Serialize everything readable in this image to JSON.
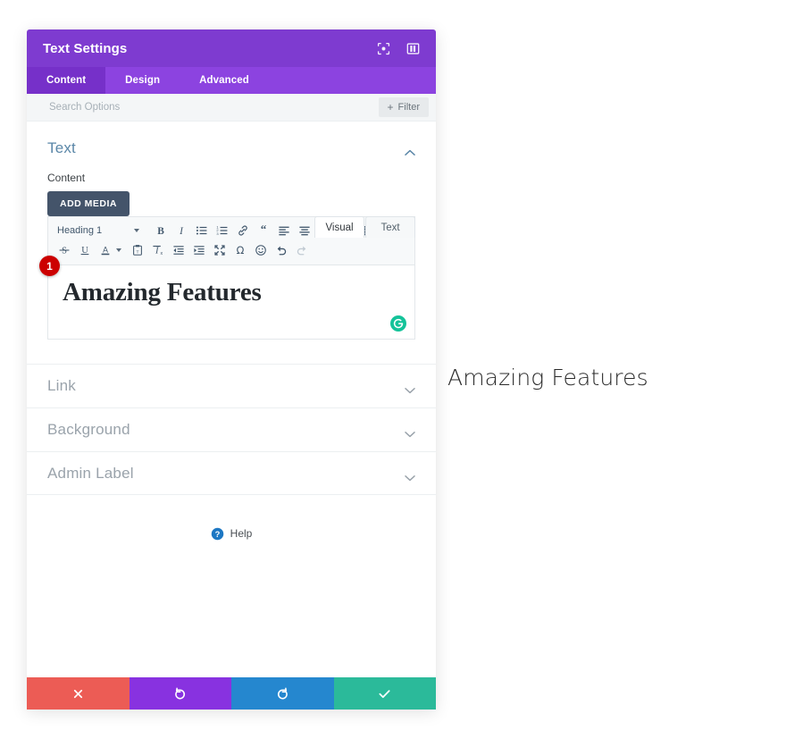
{
  "window": {
    "title": "Text Settings",
    "header_icons": [
      {
        "name": "focus-icon"
      },
      {
        "name": "layout-panel-icon"
      }
    ]
  },
  "tabs": [
    {
      "label": "Content",
      "active": true
    },
    {
      "label": "Design",
      "active": false
    },
    {
      "label": "Advanced",
      "active": false
    }
  ],
  "search": {
    "placeholder": "Search Options",
    "value": "",
    "filter_label": "Filter",
    "filter_plus": "+"
  },
  "text_section": {
    "title": "Text",
    "expanded": true,
    "content_label": "Content",
    "add_media_label": "ADD MEDIA",
    "editor_mode_tabs": [
      {
        "label": "Visual",
        "active": true
      },
      {
        "label": "Text",
        "active": false
      }
    ],
    "toolbar": {
      "format_select": "Heading 1",
      "row1": [
        "bold-icon",
        "italic-icon",
        "bulleted-list-icon",
        "numbered-list-icon",
        "link-icon",
        "blockquote-icon",
        "align-left-icon",
        "align-center-icon",
        "align-right-icon",
        "align-justify-icon",
        "table-icon"
      ],
      "row2": [
        "strikethrough-icon",
        "underline-icon",
        "text-color-icon",
        "paste-as-text-icon",
        "clear-formatting-icon",
        "outdent-icon",
        "indent-icon",
        "fullscreen-icon",
        "special-character-icon",
        "emoji-icon",
        "undo-icon",
        "redo-icon"
      ]
    },
    "editor_content": "Amazing Features",
    "grammarly_badge": "G"
  },
  "collapsed_sections": [
    {
      "label": "Link"
    },
    {
      "label": "Background"
    },
    {
      "label": "Admin Label"
    }
  ],
  "help": {
    "label": "Help",
    "icon": "question-circle-icon"
  },
  "footer_actions": [
    {
      "name": "close-button",
      "icon": "x-icon",
      "color": "#ec5c55"
    },
    {
      "name": "undo-button",
      "icon": "undo-arrow-icon",
      "color": "#8832e0"
    },
    {
      "name": "redo-button",
      "icon": "redo-arrow-icon",
      "color": "#2587cf"
    },
    {
      "name": "save-button",
      "icon": "check-icon",
      "color": "#2bba9a"
    }
  ],
  "annotations": [
    {
      "label": "1",
      "color": "#cc0000"
    }
  ],
  "canvas_preview": {
    "text": "Amazing Features"
  },
  "colors": {
    "header_purple": "#7e3bd0",
    "tabbar_purple": "#8c43e0",
    "active_tab_purple": "#7630c9",
    "section_title_blue": "#5b87a8",
    "add_media_dark": "#44546a",
    "grammarly_green": "#15c39a"
  }
}
